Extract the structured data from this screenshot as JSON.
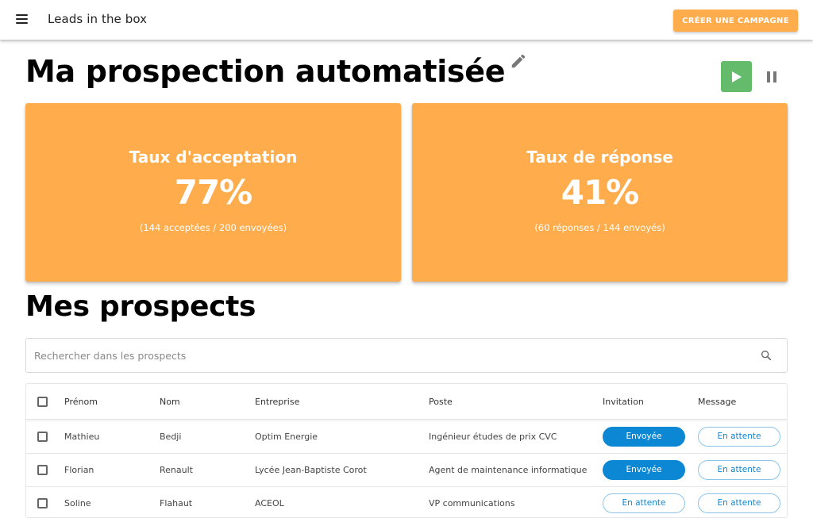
{
  "appbar": {
    "title": "Leads in the box",
    "create_button": "CRÉER UNE CAMPAGNE"
  },
  "campaign": {
    "title": "Ma prospection automatisée",
    "status": "running"
  },
  "stats": [
    {
      "label": "Taux d'acceptation",
      "value": "77%",
      "detail": "(144 acceptées / 200 envoyées)"
    },
    {
      "label": "Taux de réponse",
      "value": "41%",
      "detail": "(60 réponses / 144 envoyés)"
    }
  ],
  "prospects": {
    "title": "Mes prospects",
    "search_placeholder": "Rechercher dans les prospects",
    "search_value": "",
    "columns": [
      "Prénom",
      "Nom",
      "Entreprise",
      "Poste",
      "Invitation",
      "Message"
    ],
    "rows": [
      {
        "prenom": "Mathieu",
        "nom": "Bedji",
        "entreprise": "Optim Energie",
        "poste": "Ingénieur études de prix CVC",
        "invitation": "Envoyée",
        "invitation_state": "sent",
        "message": "En attente",
        "message_state": "pending"
      },
      {
        "prenom": "Florian",
        "nom": "Renault",
        "entreprise": "Lycée Jean-Baptiste Corot",
        "poste": "Agent de maintenance informatique",
        "invitation": "Envoyée",
        "invitation_state": "sent",
        "message": "En attente",
        "message_state": "pending"
      },
      {
        "prenom": "Soline",
        "nom": "Flahaut",
        "entreprise": "ACEOL",
        "poste": "VP communications",
        "invitation": "En attente",
        "invitation_state": "pending",
        "message": "En attente",
        "message_state": "pending"
      }
    ]
  },
  "colors": {
    "accent_orange": "#ffac4d",
    "play_green": "#63bb6b",
    "status_blue": "#0b87d4"
  }
}
